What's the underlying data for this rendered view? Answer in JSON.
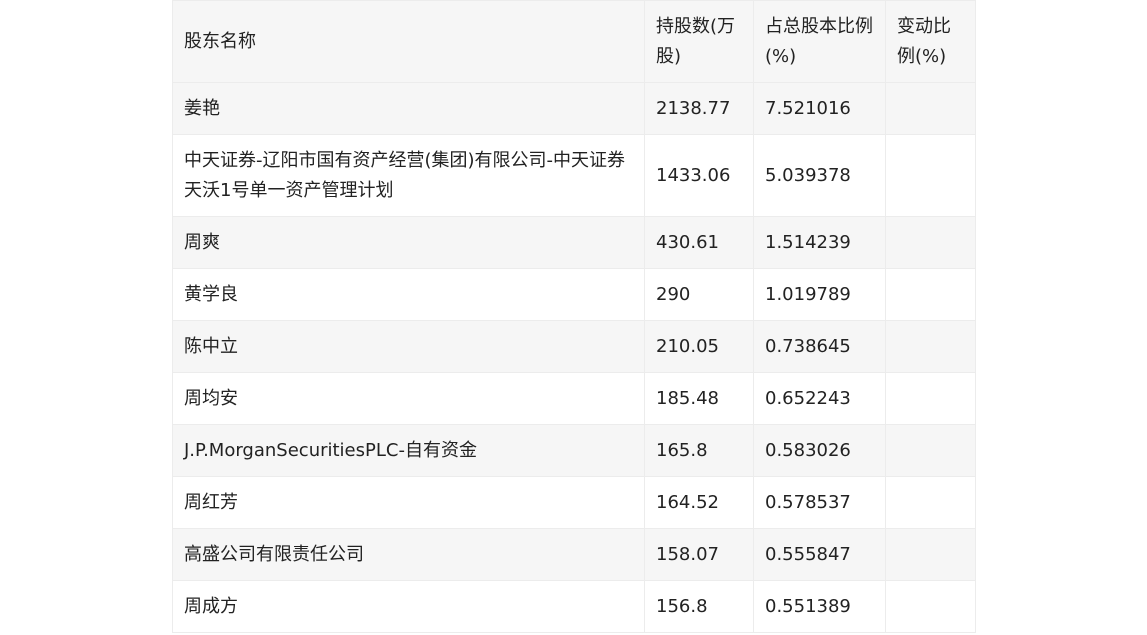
{
  "table": {
    "headers": [
      "股东名称",
      "持股数(万股)",
      "占总股本比例(%)",
      "变动比例(%)"
    ],
    "rows": [
      {
        "name": "姜艳",
        "shares": "2138.77",
        "ratio": "7.521016",
        "change": ""
      },
      {
        "name": "中天证券-辽阳市国有资产经营(集团)有限公司-中天证券天沃1号单一资产管理计划",
        "shares": "1433.06",
        "ratio": "5.039378",
        "change": ""
      },
      {
        "name": "周爽",
        "shares": "430.61",
        "ratio": "1.514239",
        "change": ""
      },
      {
        "name": "黄学良",
        "shares": "290",
        "ratio": "1.019789",
        "change": ""
      },
      {
        "name": "陈中立",
        "shares": "210.05",
        "ratio": "0.738645",
        "change": ""
      },
      {
        "name": "周均安",
        "shares": "185.48",
        "ratio": "0.652243",
        "change": ""
      },
      {
        "name": "J.P.MorganSecuritiesPLC-自有资金",
        "shares": "165.8",
        "ratio": "0.583026",
        "change": ""
      },
      {
        "name": "周红芳",
        "shares": "164.52",
        "ratio": "0.578537",
        "change": ""
      },
      {
        "name": "高盛公司有限责任公司",
        "shares": "158.07",
        "ratio": "0.555847",
        "change": ""
      },
      {
        "name": "周成方",
        "shares": "156.8",
        "ratio": "0.551389",
        "change": ""
      }
    ]
  }
}
